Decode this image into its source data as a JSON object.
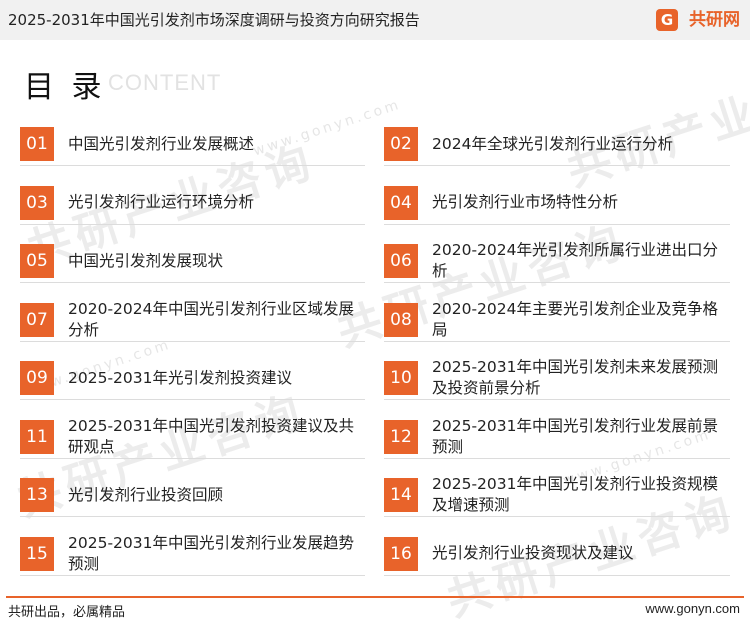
{
  "header": {
    "title": "2025-2031年中国光引发剂市场深度调研与投资方向研究报告",
    "logo_mark": "G",
    "logo_text": "共研网"
  },
  "heading": {
    "title": "目 录",
    "subtitle": "CONTENT"
  },
  "watermark": {
    "text": "共研产业咨询",
    "url": "www.gonyn.com"
  },
  "items": [
    {
      "num": "01",
      "label": "中国光引发剂行业发展概述"
    },
    {
      "num": "02",
      "label": "2024年全球光引发剂行业运行分析"
    },
    {
      "num": "03",
      "label": "光引发剂行业运行环境分析"
    },
    {
      "num": "04",
      "label": "光引发剂行业市场特性分析"
    },
    {
      "num": "05",
      "label": "中国光引发剂发展现状"
    },
    {
      "num": "06",
      "label": "2020-2024年光引发剂所属行业进出口分析"
    },
    {
      "num": "07",
      "label": "2020-2024年中国光引发剂行业区域发展分析"
    },
    {
      "num": "08",
      "label": "2020-2024年主要光引发剂企业及竞争格局"
    },
    {
      "num": "09",
      "label": "2025-2031年光引发剂投资建议"
    },
    {
      "num": "10",
      "label": "2025-2031年中国光引发剂未来发展预测及投资前景分析"
    },
    {
      "num": "11",
      "label": "2025-2031年中国光引发剂投资建议及共研观点"
    },
    {
      "num": "12",
      "label": "2025-2031年中国光引发剂行业发展前景预测"
    },
    {
      "num": "13",
      "label": "光引发剂行业投资回顾"
    },
    {
      "num": "14",
      "label": "2025-2031年中国光引发剂行业投资规模及增速预测"
    },
    {
      "num": "15",
      "label": "2025-2031年中国光引发剂行业发展趋势预测"
    },
    {
      "num": "16",
      "label": "光引发剂行业投资现状及建议"
    }
  ],
  "footer": {
    "slogan": "共研出品，必属精品",
    "url": "www.gonyn.com"
  },
  "colors": {
    "accent": "#e8632a",
    "header_bg": "#f1f1f1"
  }
}
